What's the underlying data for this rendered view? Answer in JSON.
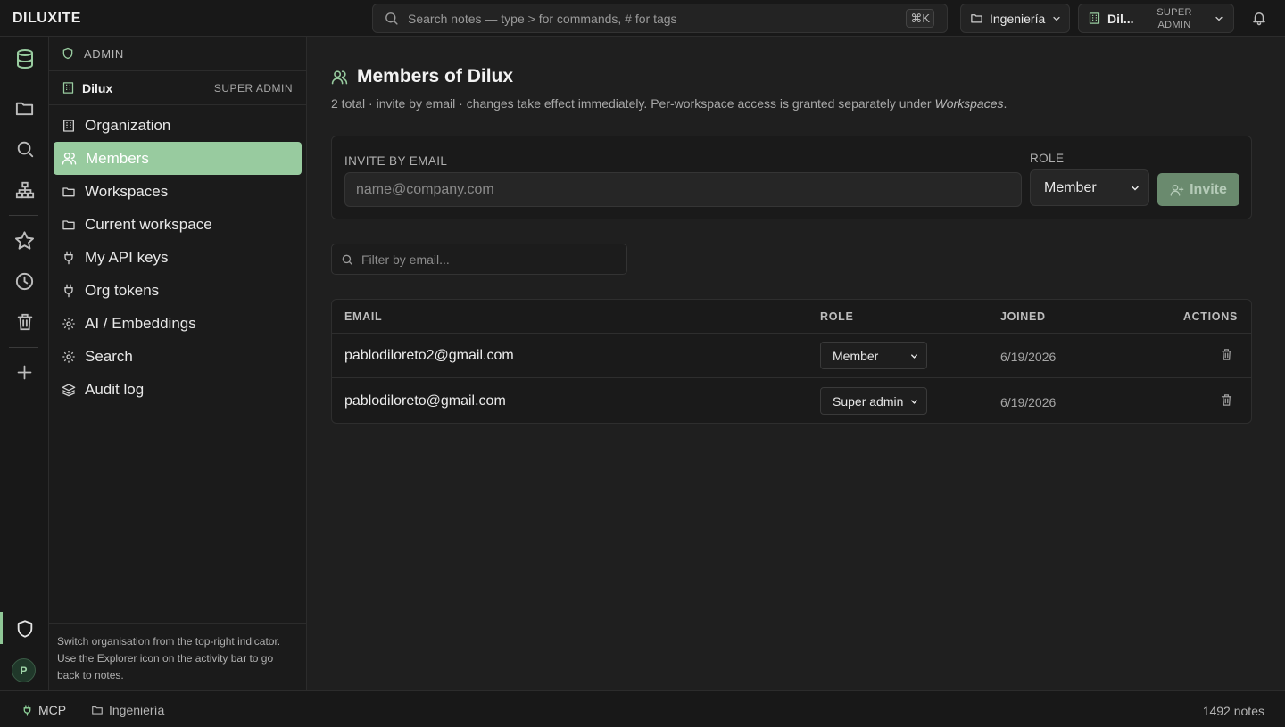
{
  "app": {
    "brand": "DILUXITE"
  },
  "topbar": {
    "search_placeholder": "Search notes — type > for commands, # for tags",
    "search_shortcut": "⌘K",
    "workspace": "Ingeniería",
    "org_name": "Dil...",
    "org_role_line1": "SUPER",
    "org_role_line2": "ADMIN"
  },
  "activity_bar": {
    "items": [
      "database-icon",
      "folder-icon",
      "search-icon",
      "sitemap-icon",
      "star-icon",
      "clock-icon",
      "trash-icon",
      "plus-icon",
      "shield-icon"
    ],
    "avatar_initial": "P"
  },
  "sidebar": {
    "header": "ADMIN",
    "org_name": "Dilux",
    "org_role": "SUPER ADMIN",
    "items": [
      {
        "label": "Organization",
        "icon": "building-icon"
      },
      {
        "label": "Members",
        "icon": "users-icon",
        "active": true
      },
      {
        "label": "Workspaces",
        "icon": "folder-icon"
      },
      {
        "label": "Current workspace",
        "icon": "folder-icon"
      },
      {
        "label": "My API keys",
        "icon": "plug-icon"
      },
      {
        "label": "Org tokens",
        "icon": "plug-icon"
      },
      {
        "label": "AI / Embeddings",
        "icon": "gear-icon"
      },
      {
        "label": "Search",
        "icon": "gear-icon"
      },
      {
        "label": "Audit log",
        "icon": "layers-icon"
      }
    ],
    "footer": "Switch organisation from the top-right indicator. Use the Explorer icon on the activity bar to go back to notes."
  },
  "main": {
    "title": "Members of Dilux",
    "subtitle_prefix": "2 total · invite by email · changes take effect immediately. Per-workspace access is granted separately under ",
    "subtitle_em": "Workspaces",
    "subtitle_suffix": ".",
    "invite": {
      "email_label": "INVITE BY EMAIL",
      "email_placeholder": "name@company.com",
      "role_label": "ROLE",
      "role_value": "Member",
      "button_label": "Invite"
    },
    "filter_placeholder": "Filter by email...",
    "table": {
      "headers": {
        "email": "EMAIL",
        "role": "ROLE",
        "joined": "JOINED",
        "actions": "ACTIONS"
      },
      "rows": [
        {
          "email": "pablodiloreto2@gmail.com",
          "role": "Member",
          "joined": "6/19/2026"
        },
        {
          "email": "pablodiloreto@gmail.com",
          "role": "Super admin",
          "joined": "6/19/2026"
        }
      ]
    }
  },
  "statusbar": {
    "mcp": "MCP",
    "workspace": "Ingeniería",
    "notes": "1492 notes"
  },
  "colors": {
    "accent": "#98cb9f",
    "accent_dim": "#6a8a6e",
    "background": "#1f1f1f"
  }
}
